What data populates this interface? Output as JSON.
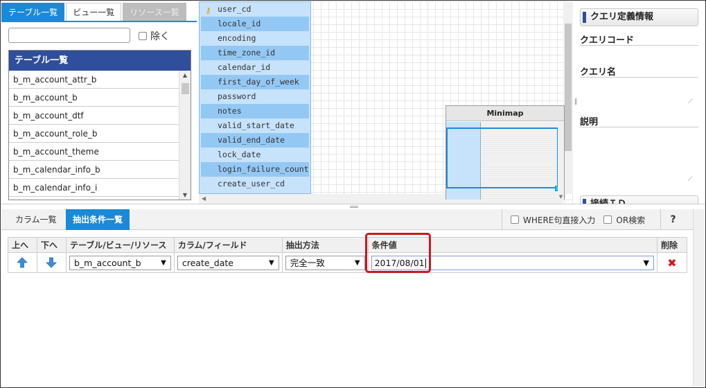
{
  "left_tabs": [
    "テーブル一覧",
    "ビュー一覧",
    "リソース一覧"
  ],
  "filter": {
    "value": "",
    "exclude_label": "除く"
  },
  "table_list": {
    "header": "テーブル一覧",
    "items": [
      "b_m_account_attr_b",
      "b_m_account_b",
      "b_m_account_dtf",
      "b_m_account_role_b",
      "b_m_account_theme",
      "b_m_calendar_info_b",
      "b_m_calendar_info_i"
    ]
  },
  "entity": {
    "fields": [
      "user_cd",
      "locale_id",
      "encoding",
      "time_zone_id",
      "calendar_id",
      "first_day_of_week",
      "password",
      "notes",
      "valid_start_date",
      "valid_end_date",
      "lock_date",
      "login_failure_count",
      "create_user_cd"
    ]
  },
  "minimap": {
    "title": "Minimap"
  },
  "right_panel": {
    "header": "クエリ定義情報",
    "query_code_label": "クエリコード",
    "query_name_label": "クエリ名",
    "description_label": "説明",
    "connection_header": "接続ＩＤ"
  },
  "bottom": {
    "tabs": [
      "カラム一覧",
      "抽出条件一覧"
    ],
    "where_direct_label": "WHERE句直接入力",
    "or_search_label": "OR検索",
    "help_label": "?",
    "columns": [
      "上へ",
      "下へ",
      "テーブル/ビュー/リソース",
      "カラム/フィールド",
      "抽出方法",
      "条件値",
      "削除"
    ],
    "row": {
      "table": "b_m_account_b",
      "column": "create_date",
      "method": "完全一致",
      "value": "2017/08/01"
    }
  },
  "icons": {
    "key": "key-icon",
    "up": "arrow-up-icon",
    "down": "arrow-down-icon",
    "delete": "delete-x-icon"
  },
  "colors": {
    "accent": "#1a8ad6",
    "header_navy": "#2f4f9c",
    "entity_fill": "#c7e2fb",
    "entity_alt": "#94c8f4",
    "highlight": "#d0161a"
  }
}
